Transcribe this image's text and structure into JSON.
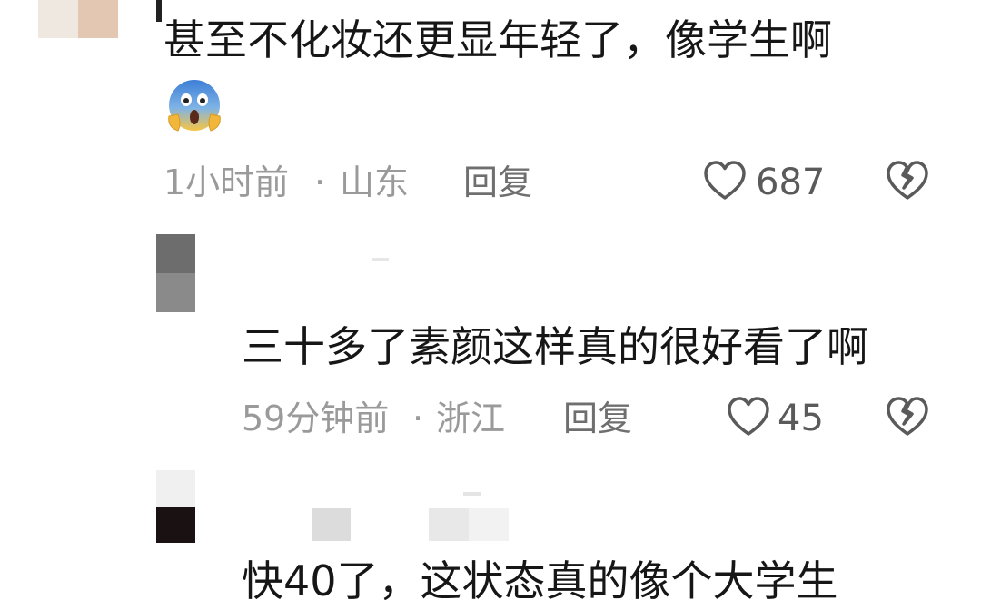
{
  "comments": [
    {
      "text": "甚至不化妆还更显年轻了，像学生啊",
      "emoji": "😱",
      "time": "1小时前",
      "separator": "·",
      "location": "山东",
      "reply_label": "回复",
      "likes": "687"
    },
    {
      "text": "三十多了素颜这样真的很好看了啊",
      "time": "59分钟前",
      "separator": "·",
      "location": "浙江",
      "reply_label": "回复",
      "likes": "45"
    },
    {
      "text": "快40了，这状态真的像个大学生"
    }
  ],
  "colors": {
    "text": "#161616",
    "meta": "#9a9a9a",
    "icon": "#5a5a5a"
  }
}
